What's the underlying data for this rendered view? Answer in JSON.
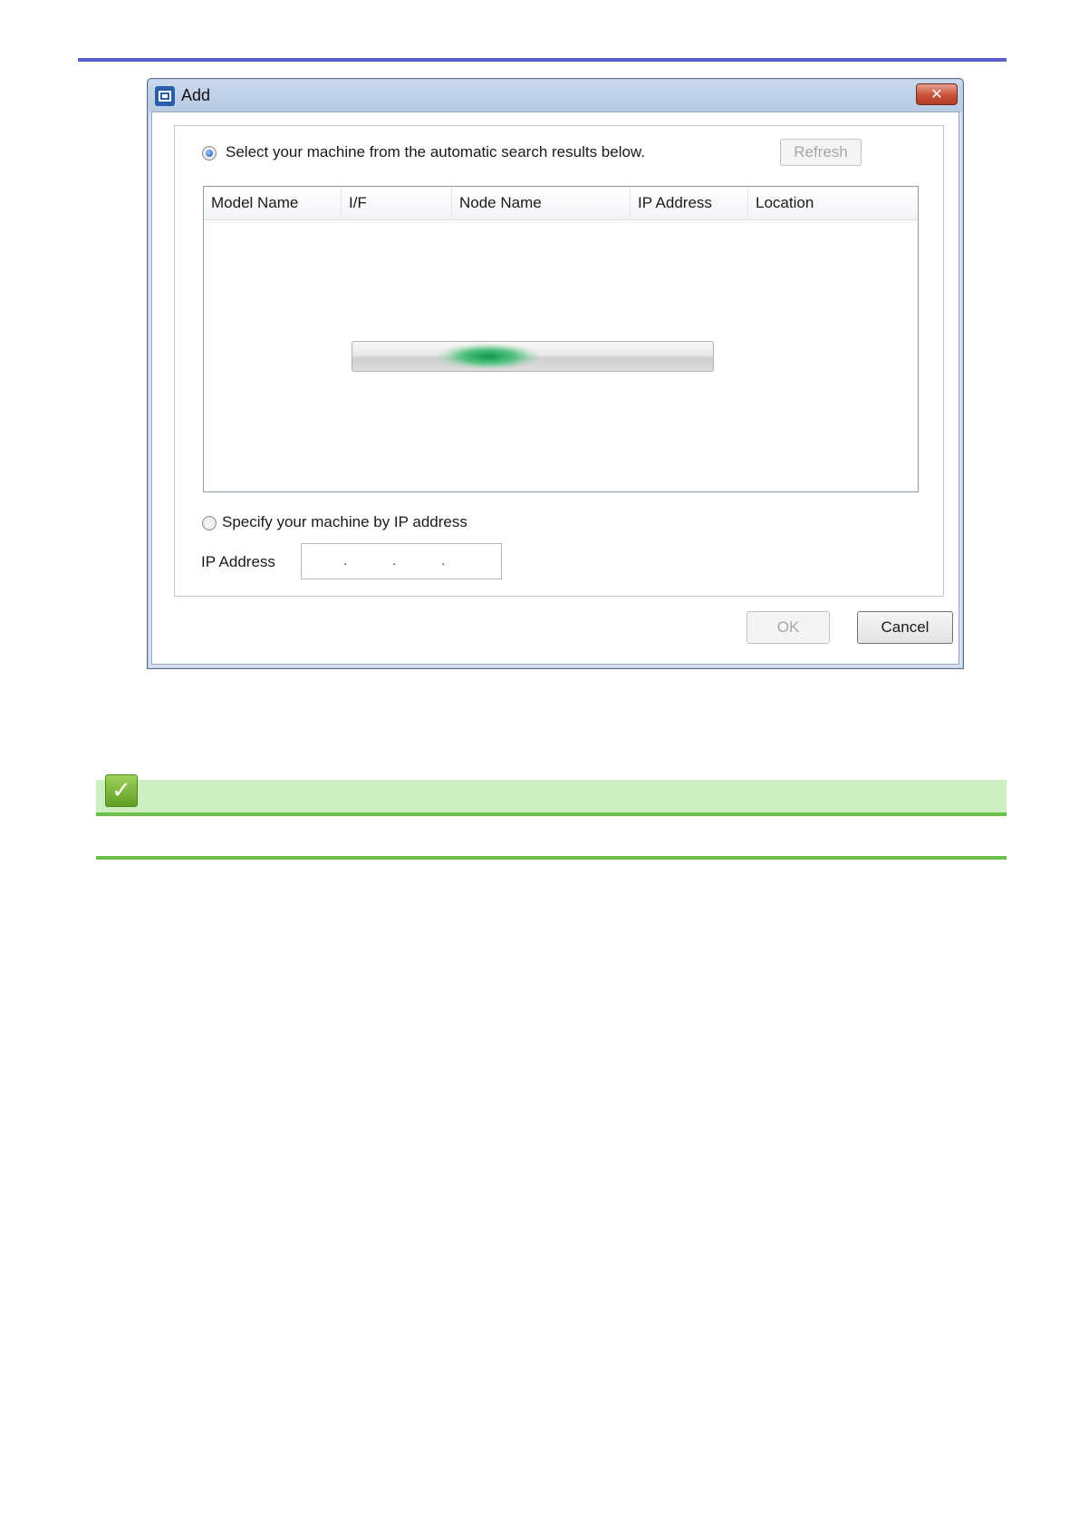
{
  "window": {
    "title": "Add",
    "close_glyph": "✕"
  },
  "auto_search": {
    "radio_label": "Select your machine from the automatic search results  below.",
    "selected": true,
    "refresh_label": "Refresh",
    "refresh_enabled": false
  },
  "list": {
    "columns": [
      "Model Name",
      "I/F",
      "Node Name",
      "IP Address",
      "Location"
    ],
    "rows": [],
    "progress": {
      "state": "indeterminate",
      "color": "#0f9a4d"
    }
  },
  "manual": {
    "radio_label": "Specify your machine by IP address",
    "selected": false,
    "ip_label": "IP Address",
    "ip_separators": [
      ".",
      ".",
      "."
    ]
  },
  "footer": {
    "ok_label": "OK",
    "ok_enabled": false,
    "cancel_label": "Cancel"
  },
  "note": {
    "icon": "check-icon",
    "icon_glyph": "✓",
    "accent": "#6cc04a",
    "background": "#cdeec0"
  },
  "page": {
    "rule_color": "#5a5fd0"
  }
}
